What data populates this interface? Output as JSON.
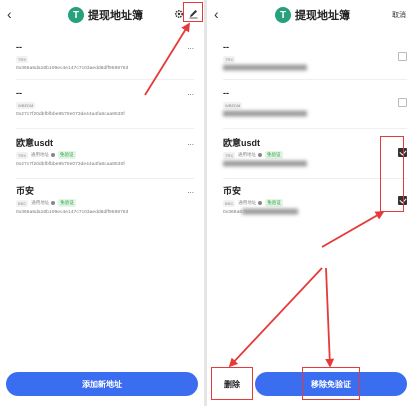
{
  "left": {
    "back_icon": "chevron-left-icon",
    "logo_letter": "T",
    "title": "提现地址簿",
    "menu": "...",
    "items": [
      {
        "name": "--",
        "network": "TRX",
        "address": "0x366a6da18b109ec4e147c7c03aedd8dff9698763"
      },
      {
        "name": "--",
        "network": "WBEDM",
        "address": "0x27c7f20dbfbfbbe9570e073de44a4fa6caa8530f"
      },
      {
        "name": "欧意usdt",
        "network": "TRX",
        "general": "通用地址",
        "exempt": "免验证",
        "address": "0x27c7f20dbfbfbbe9570e073de44a4fa6caa8530f"
      },
      {
        "name": "币安",
        "network": "BSC",
        "general": "通用地址",
        "exempt": "免验证",
        "address": "0x366a6da18b109ec4e147c7c03aedd8dff9698763"
      }
    ],
    "add_button": "添加新地址"
  },
  "right": {
    "back_icon": "chevron-left-icon",
    "logo_letter": "T",
    "title": "提现地址簿",
    "cancel": "取消",
    "items": [
      {
        "name": "--",
        "network": "TRX",
        "checked": false
      },
      {
        "name": "--",
        "network": "WBEDM",
        "checked": false
      },
      {
        "name": "欧意usdt",
        "network": "TRX",
        "general": "通用地址",
        "exempt": "免验证",
        "checked": true
      },
      {
        "name": "币安",
        "network": "BSC",
        "general": "通用地址",
        "exempt": "免验证",
        "address_prefix": "0x366a6",
        "checked": true
      }
    ],
    "delete_button": "删除",
    "remove_exempt_button": "移除免验证"
  },
  "colors": {
    "accent": "#3a6df0",
    "annotation": "#e53a3a",
    "exempt_green": "#2e9e44",
    "logo": "#26a17b"
  }
}
